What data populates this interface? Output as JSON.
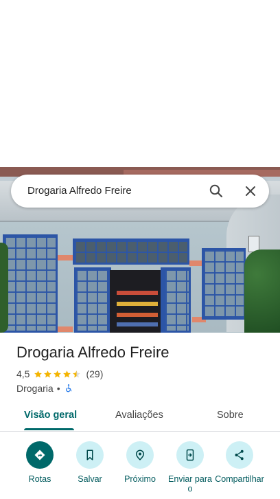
{
  "search": {
    "query": "Drogaria Alfredo Freire",
    "search_icon": "search-icon",
    "close_icon": "close-icon"
  },
  "place": {
    "name": "Drogaria Alfredo Freire",
    "rating": "4,5",
    "stars": 4.5,
    "review_count": "(29)",
    "category": "Drogaria",
    "separator": "•",
    "accessibility_icon": "wheelchair-icon"
  },
  "tabs": [
    {
      "label": "Visão geral",
      "active": true
    },
    {
      "label": "Avaliações",
      "active": false
    },
    {
      "label": "Sobre",
      "active": false
    }
  ],
  "actions": [
    {
      "label": "Rotas",
      "icon": "directions-icon"
    },
    {
      "label": "Salvar",
      "icon": "bookmark-icon"
    },
    {
      "label": "Próximo",
      "icon": "nearby-icon"
    },
    {
      "label": "Enviar para o",
      "icon": "send-to-phone-icon"
    },
    {
      "label": "Compartilhar",
      "icon": "share-icon"
    }
  ],
  "colors": {
    "accent": "#00696a",
    "action_bg": "#cdf0f5",
    "star": "#f4b400",
    "wheelchair": "#1a73e8"
  }
}
